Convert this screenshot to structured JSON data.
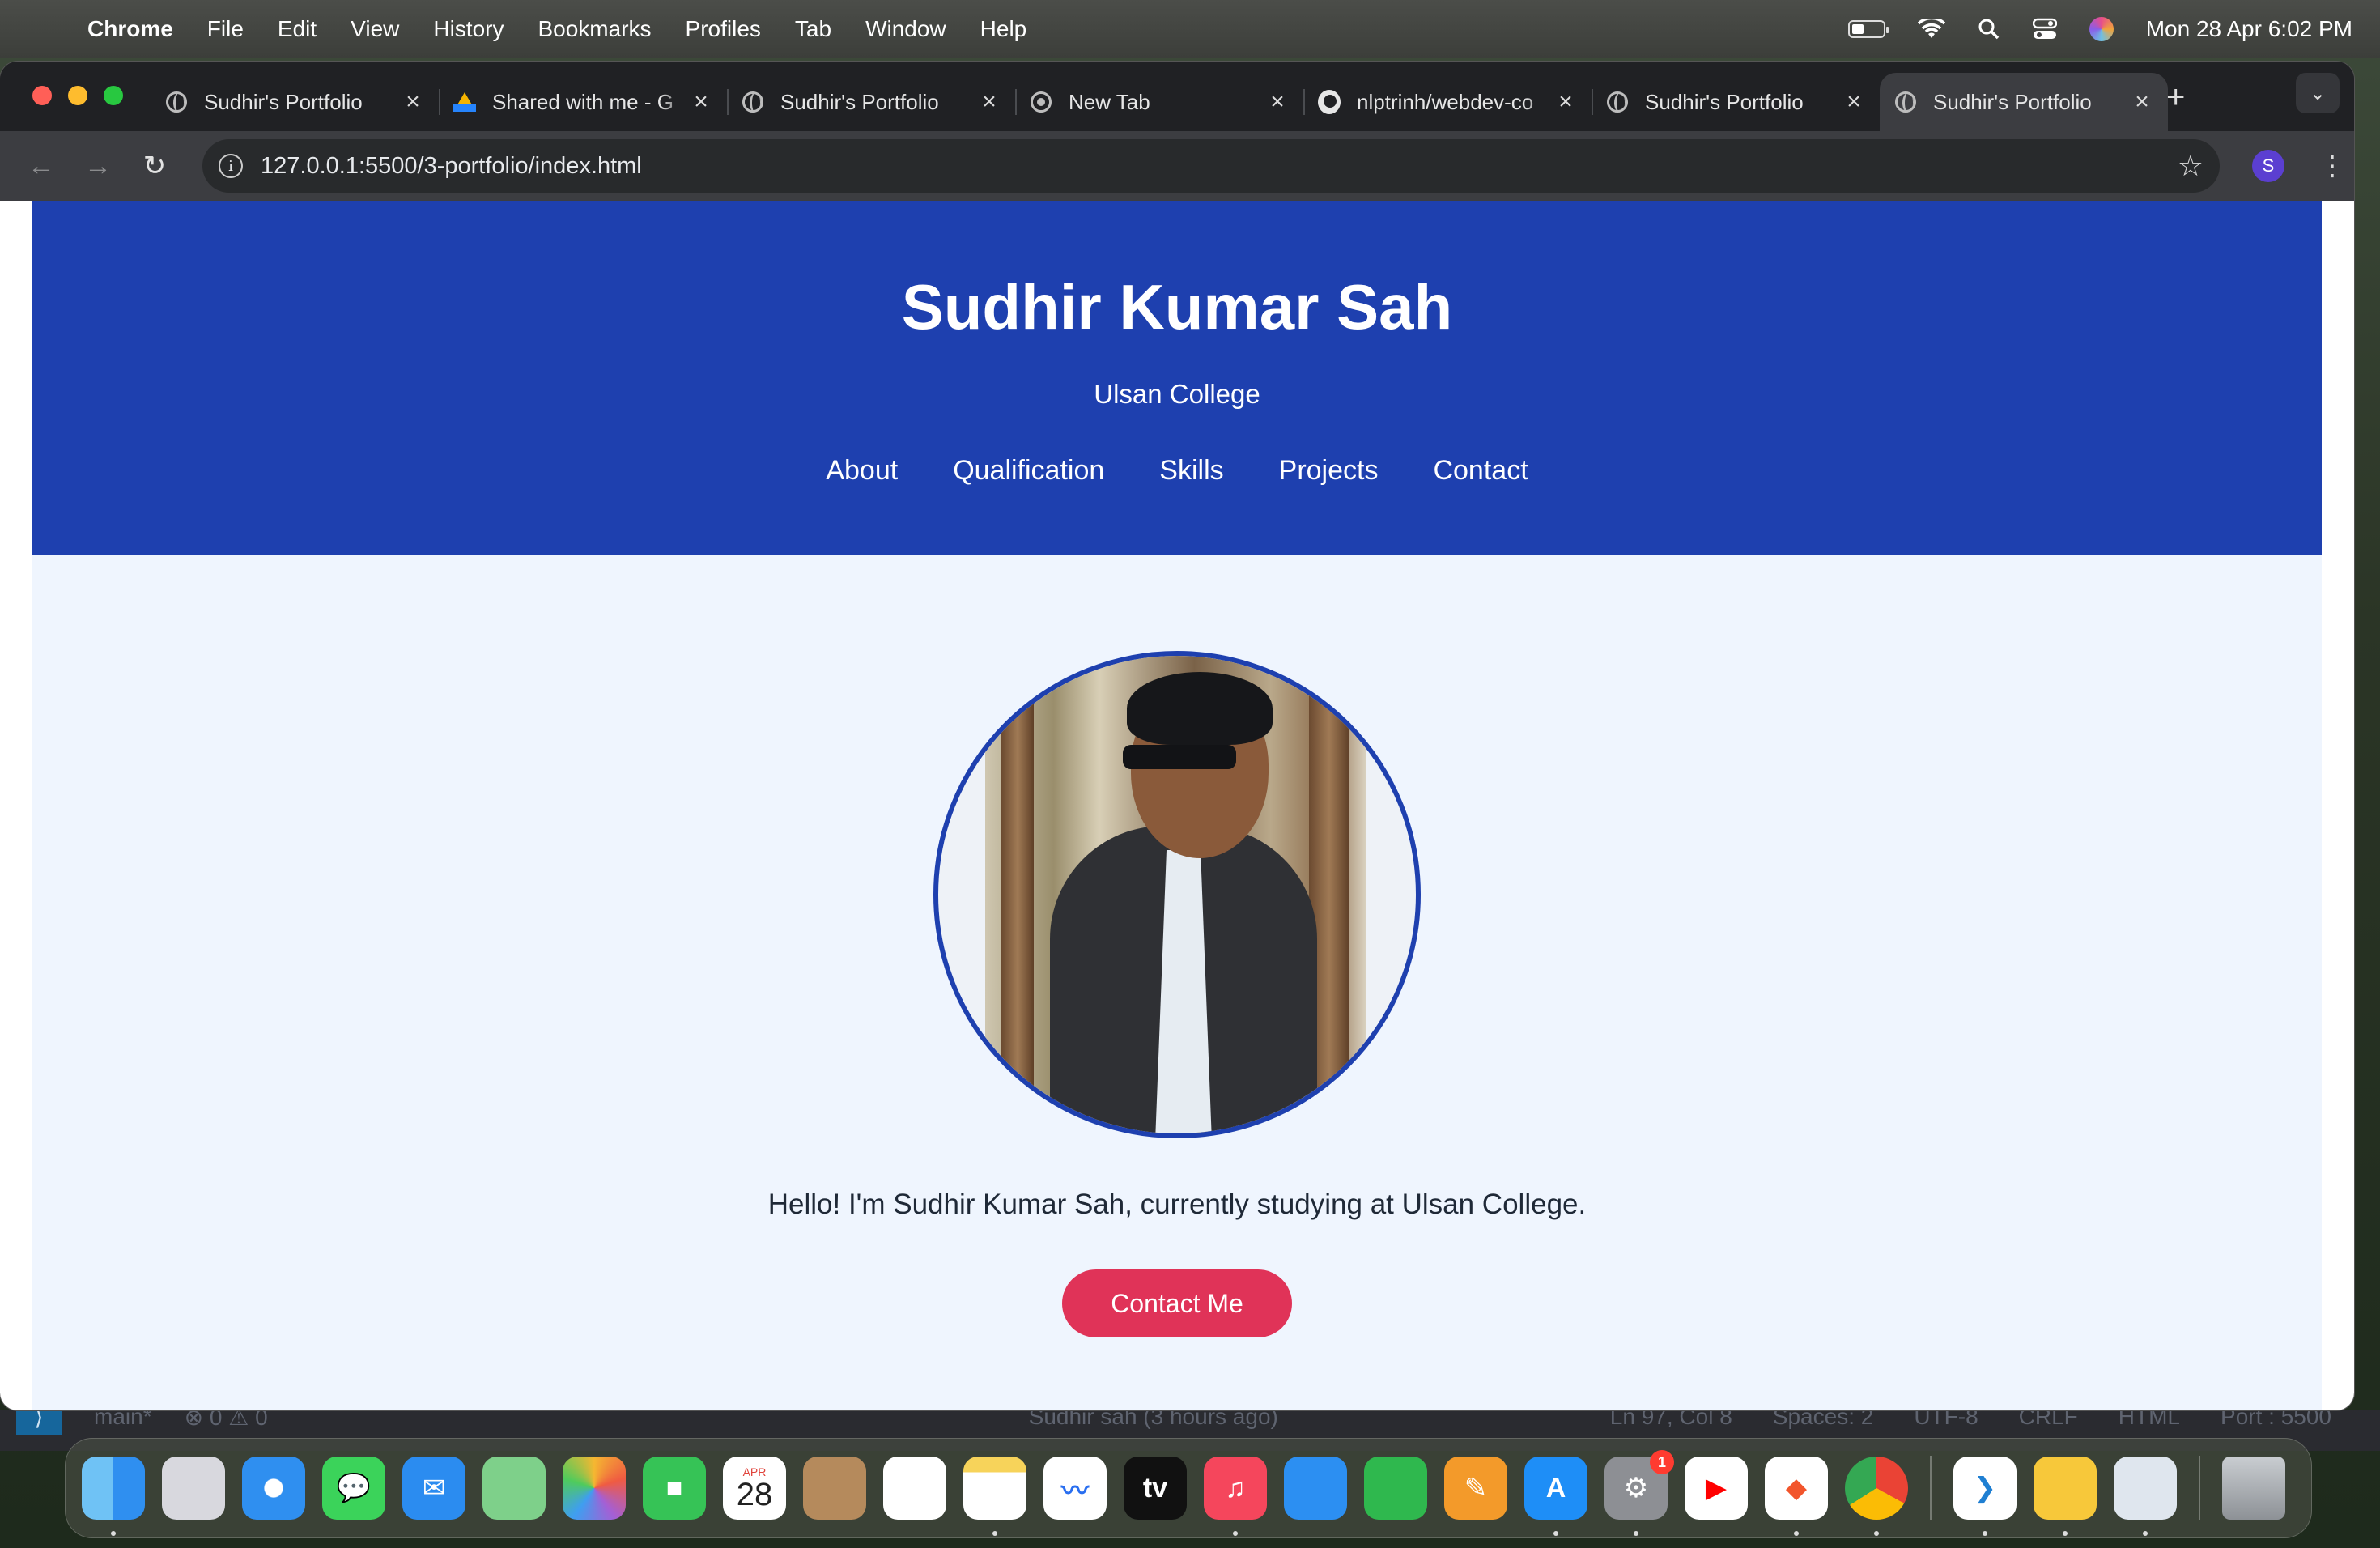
{
  "menubar": {
    "app": "Chrome",
    "items": [
      "File",
      "Edit",
      "View",
      "History",
      "Bookmarks",
      "Profiles",
      "Tab",
      "Window",
      "Help"
    ],
    "clock": "Mon 28 Apr  6:02 PM"
  },
  "tabs": [
    {
      "title": "Sudhir's Portfolio",
      "icon": "globe-icon"
    },
    {
      "title": "Shared with me - G",
      "icon": "google-drive-icon"
    },
    {
      "title": "Sudhir's Portfolio",
      "icon": "globe-icon"
    },
    {
      "title": "New Tab",
      "icon": "chrome-icon"
    },
    {
      "title": "nlptrinh/webdev-co",
      "icon": "github-icon"
    },
    {
      "title": "Sudhir's Portfolio",
      "icon": "globe-icon"
    },
    {
      "title": "Sudhir's Portfolio",
      "icon": "globe-icon",
      "active": true
    }
  ],
  "toolbar": {
    "url": "127.0.0.1:5500/3-portfolio/index.html",
    "profile_initial": "S"
  },
  "page": {
    "name": "Sudhir Kumar Sah",
    "college": "Ulsan College",
    "nav": [
      "About",
      "Qualification",
      "Skills",
      "Projects",
      "Contact"
    ],
    "intro": "Hello! I'm Sudhir Kumar Sah, currently studying at Ulsan College.",
    "cta": "Contact Me",
    "colors": {
      "header": "#1e40af",
      "background": "#eff5fe",
      "cta": "#e03358"
    }
  },
  "vscode_status": {
    "branch": "main*",
    "problems": "0 ⚠ 0",
    "blame": "Sudhir sah (3 hours ago)",
    "position": "Ln 97, Col 8",
    "spaces": "Spaces: 2",
    "encoding": "UTF-8",
    "eol": "CRLF",
    "language": "HTML",
    "port": "Port : 5500"
  },
  "dock": {
    "calendar_month": "APR",
    "calendar_day": "28",
    "settings_badge": "1",
    "apps": [
      "finder-icon",
      "launchpad-icon",
      "safari-icon",
      "messages-icon",
      "mail-icon",
      "maps-icon",
      "photos-icon",
      "facetime-icon",
      "calendar-icon",
      "contacts-icon",
      "reminders-icon",
      "notes-icon",
      "freeform-icon",
      "apple-tv-icon",
      "music-icon",
      "keynote-icon",
      "numbers-icon",
      "pages-icon",
      "app-store-icon",
      "system-settings-icon",
      "youtube-icon",
      "brave-icon",
      "chrome-icon",
      "vscode-icon",
      "whatsapp-icon",
      "preview-icon",
      "trash-icon"
    ]
  }
}
